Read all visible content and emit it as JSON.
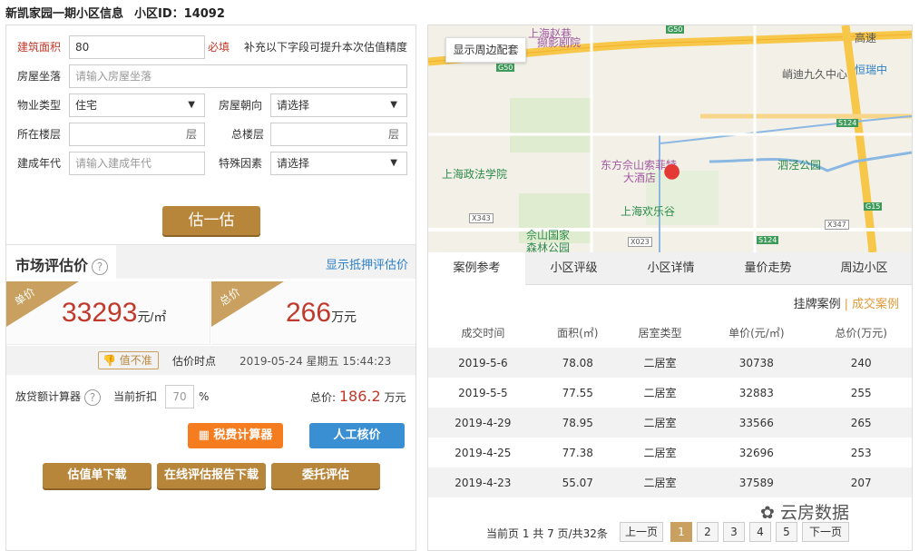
{
  "title": {
    "name": "新凯家园一期小区信息",
    "id_label": "小区ID：14092"
  },
  "form": {
    "area": {
      "label": "建筑面积",
      "value": "80",
      "required": "必填",
      "hint": "补充以下字段可提升本次估值精度"
    },
    "address": {
      "label": "房屋坐落",
      "placeholder": "请输入房屋坐落"
    },
    "property_type": {
      "label": "物业类型",
      "value": "住宅"
    },
    "orientation": {
      "label": "房屋朝向",
      "value": "请选择"
    },
    "floor": {
      "label": "所在楼层",
      "suffix": "层"
    },
    "total_floors": {
      "label": "总楼层",
      "suffix": "层"
    },
    "build_year": {
      "label": "建成年代",
      "placeholder": "请输入建成年代"
    },
    "special": {
      "label": "特殊因素",
      "value": "请选择"
    },
    "estimate_button": "估一估"
  },
  "market": {
    "title": "市场评估价",
    "help": "?",
    "mortgage_link": "显示抵押评估价",
    "unit_ribbon": "单价",
    "unit_price": "33293",
    "unit_price_unit": "元/㎡",
    "total_ribbon": "总价",
    "total_price": "266",
    "total_price_unit": "万元",
    "not_accurate": "值不准",
    "time_label": "估价时点",
    "time_value": "2019-05-24 星期五 15:44:23"
  },
  "loan": {
    "label": "放贷额计算器",
    "help": "?",
    "discount_label": "当前折扣",
    "discount_value": "70",
    "percent": "%",
    "total_label": "总价:",
    "total_value": "186.2",
    "total_unit": "万元"
  },
  "buttons": {
    "tax": "税费计算器",
    "manual": "人工核价",
    "download": "估值单下载",
    "report": "在线评估报告下载",
    "entrust": "委托评估"
  },
  "map": {
    "button": "显示周边配套",
    "labels": [
      "上海赵巷",
      "撷影剧院",
      "峭迪九久中心",
      "恒瑞中",
      "东方佘山索菲特",
      "大酒店",
      "泗泾公园",
      "上海政法学院",
      "上海欢乐谷",
      "佘山国家",
      "森林公园",
      "高速"
    ],
    "roads": [
      "G50",
      "G50",
      "S124",
      "X343",
      "X023",
      "S124",
      "X347",
      "G15"
    ]
  },
  "tabs": [
    "案例参考",
    "小区评级",
    "小区详情",
    "量价走势",
    "周边小区"
  ],
  "cases": {
    "link_listing": "挂牌案例",
    "sep": "|",
    "link_deal": "成交案例",
    "headers": [
      "成交时间",
      "面积(㎡)",
      "居室类型",
      "单价(元/㎡)",
      "总价(万元)"
    ],
    "rows": [
      [
        "2019-5-6",
        "78.08",
        "二居室",
        "30738",
        "240"
      ],
      [
        "2019-5-5",
        "77.55",
        "二居室",
        "32883",
        "255"
      ],
      [
        "2019-4-29",
        "78.95",
        "二居室",
        "33566",
        "265"
      ],
      [
        "2019-4-25",
        "77.38",
        "二居室",
        "32696",
        "253"
      ],
      [
        "2019-4-23",
        "55.07",
        "二居室",
        "37589",
        "207"
      ]
    ]
  },
  "pager": {
    "info": "当前页 1 共 7 页/共32条",
    "prev": "上一页",
    "pages": [
      "1",
      "2",
      "3",
      "4",
      "5"
    ],
    "next": "下一页"
  },
  "watermark": "云房数据",
  "colors": {
    "accent_gold": "#b8863b",
    "price_red": "#c0392b",
    "link_blue": "#2a7fc4",
    "orange": "#f57c1f",
    "blue_button": "#3a8fd3"
  }
}
